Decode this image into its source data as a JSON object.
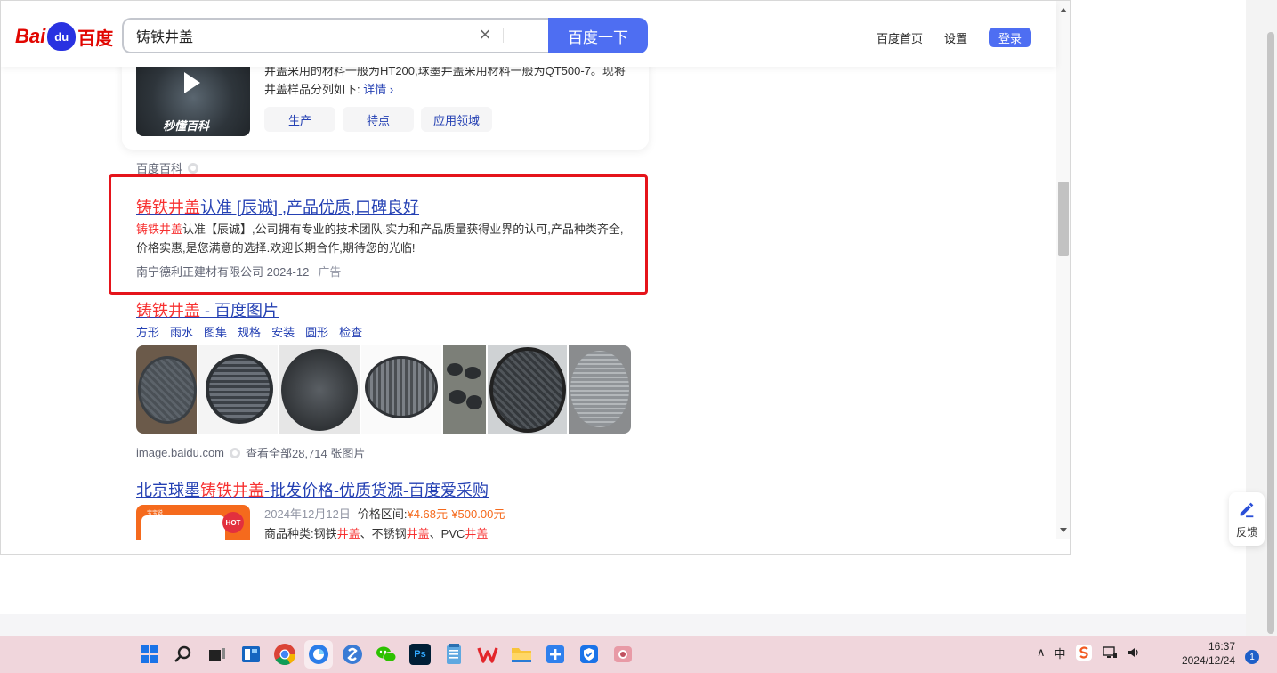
{
  "search": {
    "query": "铸铁井盖",
    "button_label": "百度一下",
    "clear_icon": "close-icon"
  },
  "logo": {
    "bai": "Bai",
    "du": "du",
    "baidu_cn": "百度"
  },
  "nav": {
    "home": "百度首页",
    "settings": "设置",
    "login": "登录"
  },
  "baike": {
    "text_line1": "井盖采用的材料一般为HT200,球墨井盖采用材料一般为QT500-7。现将",
    "text_line2": "井盖样品分列如下:",
    "detail": "详情",
    "watermark": "秒懂百科",
    "tags": [
      "生产",
      "特点",
      "应用领域"
    ],
    "source": "百度百科"
  },
  "ad": {
    "title_red": "铸铁井盖",
    "title_rest": "认准 [辰诚] ,产品优质,口碑良好",
    "desc_red": "铸铁井盖",
    "desc_rest": "认准【辰诚】,公司拥有专业的技术团队,实力和产品质量获得业界的认可,产品种类齐全,价格实惠,是您满意的选择.欢迎长期合作,期待您的光临!",
    "source": "南宁德利正建材有限公司 2024-12",
    "ad_mark": "广告"
  },
  "images": {
    "title_red": "铸铁井盖",
    "title_rest": " - 百度图片",
    "tags": [
      "方形",
      "雨水",
      "图集",
      "规格",
      "安装",
      "圆形",
      "检查"
    ],
    "domain": "image.baidu.com",
    "view_all": "查看全部28,714 张图片"
  },
  "shop": {
    "title_pre": "北京球墨",
    "title_red": "铸铁井盖",
    "title_post": "-批发价格-优质货源-百度爱采购",
    "date": "2024年12月12日",
    "price_label": "价格区间:",
    "price": "¥4.68元-¥500.00元",
    "cat_label": "商品种类:钢铁",
    "cat_red1": "井盖",
    "cat_mid1": "、不锈钢",
    "cat_red2": "井盖",
    "cat_mid2": "、PVC",
    "cat_red3": "井盖",
    "thumb_label": "宝宝说",
    "hot": "HOT"
  },
  "feedback": {
    "label": "反馈"
  },
  "taskbar": {
    "ime": "中",
    "time": "16:37",
    "date": "2024/12/24",
    "notifications": "1",
    "ps_label": "Ps"
  },
  "colors": {
    "accent": "#4e6ef2",
    "link": "#2440b3",
    "highlight": "#f73131",
    "ad_border": "#e5141b"
  }
}
